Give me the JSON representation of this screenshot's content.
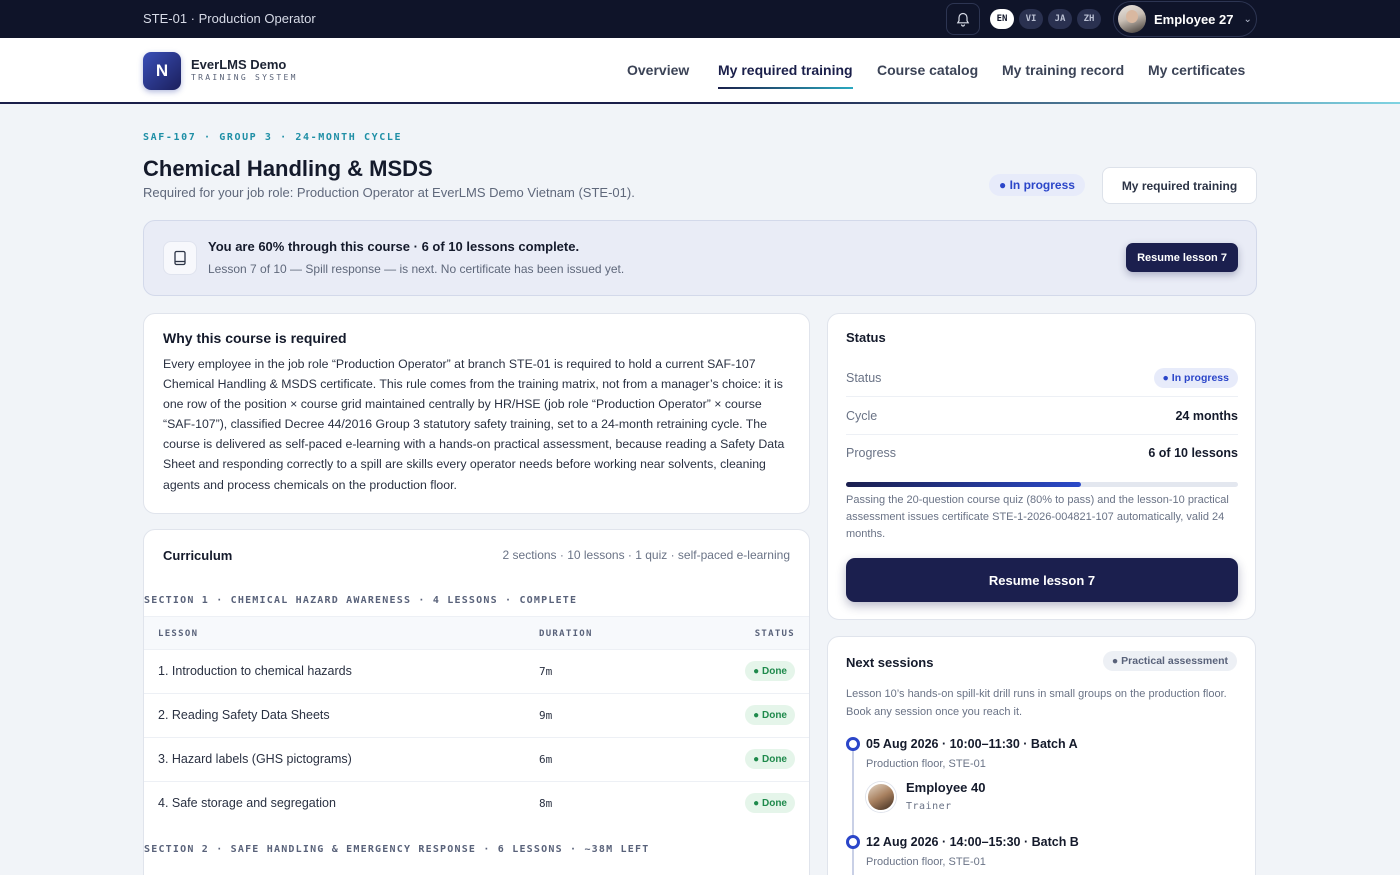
{
  "topbar": {
    "context": "STE-01 · Production Operator",
    "languages": [
      {
        "code": "EN",
        "active": true
      },
      {
        "code": "VI",
        "active": false
      },
      {
        "code": "JA",
        "active": false
      },
      {
        "code": "ZH",
        "active": false
      }
    ],
    "user_name": "Employee 27",
    "icons": {
      "bell": "bell-icon",
      "chevron": "chevron-down-icon"
    }
  },
  "header": {
    "logo_letter": "N",
    "brand": "EverLMS Demo",
    "brand_sub": "TRAINING SYSTEM",
    "nav": [
      {
        "label": "Overview",
        "active": false
      },
      {
        "label": "My required training",
        "active": true
      },
      {
        "label": "Course catalog",
        "active": false
      },
      {
        "label": "My training record",
        "active": false
      },
      {
        "label": "My certificates",
        "active": false
      }
    ]
  },
  "page": {
    "eyebrow": "SAF-107 · GROUP 3 · 24-MONTH CYCLE",
    "title": "Chemical Handling & MSDS",
    "subtitle": "Required for your job role: Production Operator at EverLMS Demo Vietnam (STE-01).",
    "status_pill": "● In progress",
    "back_button": "My required training"
  },
  "banner": {
    "title": "You are 60% through this course · 6 of 10 lessons complete.",
    "subtitle": "Lesson 7 of 10 — Spill response — is next. No certificate has been issued yet.",
    "button": "Resume lesson 7",
    "icon": "book-icon"
  },
  "why": {
    "title": "Why this course is required",
    "body": "Every employee in the job role “Production Operator” at branch STE-01 is required to hold a current SAF-107 Chemical Handling & MSDS certificate. This rule comes from the training matrix, not from a manager’s choice: it is one row of the position × course grid maintained centrally by HR/HSE (job role “Production Operator” × course “SAF-107”), classified Decree 44/2016 Group 3 statutory safety training, set to a 24-month retraining cycle. The course is delivered as self-paced e-learning with a hands-on practical assessment, because reading a Safety Data Sheet and responding correctly to a spill are skills every operator needs before working near solvents, cleaning agents and process chemicals on the production floor."
  },
  "curriculum": {
    "title": "Curriculum",
    "meta": "2 sections · 10 lessons · 1 quiz · self-paced e-learning",
    "section1": "SECTION 1 · CHEMICAL HAZARD AWARENESS · 4 LESSONS · COMPLETE",
    "columns": {
      "lesson": "LESSON",
      "duration": "DURATION",
      "status": "STATUS"
    },
    "lessons": [
      {
        "name": "1. Introduction to chemical hazards",
        "duration": "7m",
        "status": "● Done"
      },
      {
        "name": "2. Reading Safety Data Sheets",
        "duration": "9m",
        "status": "● Done"
      },
      {
        "name": "3. Hazard labels (GHS pictograms)",
        "duration": "6m",
        "status": "● Done"
      },
      {
        "name": "4. Safe storage and segregation",
        "duration": "8m",
        "status": "● Done"
      }
    ],
    "section2": "SECTION 2 · SAFE HANDLING & EMERGENCY RESPONSE · 6 LESSONS · ~38M LEFT"
  },
  "status_card": {
    "title": "Status",
    "rows": {
      "status_label": "Status",
      "status_value": "● In progress",
      "cycle_label": "Cycle",
      "cycle_value": "24 months",
      "progress_label": "Progress",
      "progress_value": "6 of 10 lessons"
    },
    "progress_fraction": 0.6,
    "note": "Passing the 20-question course quiz (80% to pass) and the lesson-10 practical assessment issues certificate STE-1-2026-004821-107 automatically, valid 24 months.",
    "button": "Resume lesson 7"
  },
  "sessions": {
    "title": "Next sessions",
    "pill": "● Practical assessment",
    "note": "Lesson 10’s hands-on spill-kit drill runs in small groups on the production floor. Book any session once you reach it.",
    "items": [
      {
        "head": "05 Aug 2026 · 10:00–11:30 · Batch A",
        "location": "Production floor, STE-01",
        "trainer_name": "Employee 40",
        "trainer_role": "Trainer"
      },
      {
        "head": "12 Aug 2026 · 14:00–15:30 · Batch B",
        "location": "Production floor, STE-01"
      }
    ]
  },
  "colors": {
    "navy": "#1b1f4e",
    "accent_blue": "#2b46c9",
    "teal": "#1f8fa6",
    "done_green": "#1f8a4c"
  }
}
